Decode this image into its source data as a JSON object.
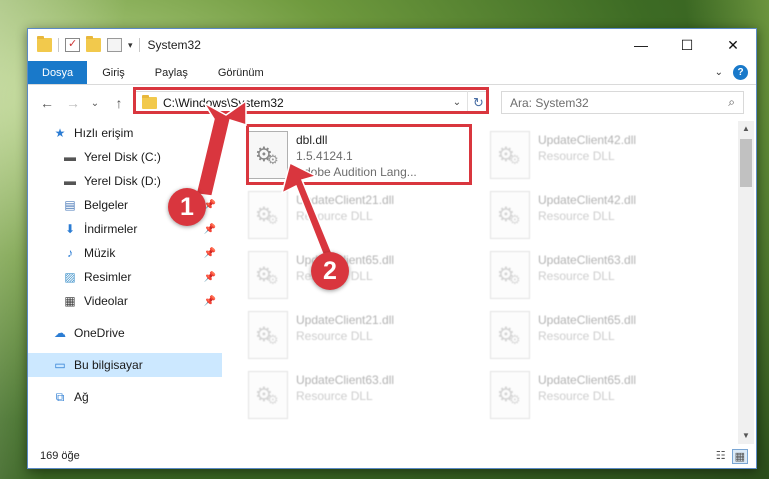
{
  "window": {
    "title": "System32",
    "min_label": "—",
    "max_label": "☐",
    "close_label": "✕"
  },
  "ribbon": {
    "tabs": [
      "Dosya",
      "Giriş",
      "Paylaş",
      "Görünüm"
    ],
    "help_label": "?"
  },
  "nav": {
    "back": "←",
    "forward": "→",
    "recent": "⌄",
    "up": "↑"
  },
  "address": {
    "path": "C:\\Windows\\System32",
    "refresh": "↻"
  },
  "search": {
    "placeholder": "Ara: System32",
    "icon": "⌕"
  },
  "sidebar": {
    "items": [
      {
        "label": "Hızlı erişim",
        "icon": "star-icon",
        "glyph": "★",
        "pinned": false
      },
      {
        "label": "Yerel Disk (C:)",
        "icon": "drive-icon",
        "glyph": "▬",
        "pinned": true
      },
      {
        "label": "Yerel Disk (D:)",
        "icon": "drive-icon",
        "glyph": "▬",
        "pinned": true
      },
      {
        "label": "Belgeler",
        "icon": "documents-icon",
        "glyph": "▤",
        "pinned": true
      },
      {
        "label": "İndirmeler",
        "icon": "downloads-icon",
        "glyph": "⬇",
        "pinned": true
      },
      {
        "label": "Müzik",
        "icon": "music-icon",
        "glyph": "♪",
        "pinned": true
      },
      {
        "label": "Resimler",
        "icon": "pictures-icon",
        "glyph": "▨",
        "pinned": true
      },
      {
        "label": "Videolar",
        "icon": "videos-icon",
        "glyph": "▦",
        "pinned": true
      },
      {
        "label": "OneDrive",
        "icon": "cloud-icon",
        "glyph": "☁",
        "pinned": false
      },
      {
        "label": "Bu bilgisayar",
        "icon": "computer-icon",
        "glyph": "▭",
        "pinned": false
      },
      {
        "label": "Ağ",
        "icon": "network-icon",
        "glyph": "⧉",
        "pinned": false
      }
    ],
    "pin_glyph": "📌"
  },
  "files": {
    "highlighted": {
      "name": "dbl.dll",
      "version": "1.5.4124.1",
      "description": "Adobe Audition Lang..."
    },
    "tiles": [
      {
        "name": "UpdateClient42.dll",
        "type": "Resource DLL"
      },
      {
        "name": "UpdateClient21.dll",
        "type": "Resource DLL"
      },
      {
        "name": "UpdateClient42.dll",
        "type": "Resource DLL"
      },
      {
        "name": "UpdateClient65.dll",
        "type": "Resource DLL"
      },
      {
        "name": "UpdateClient63.dll",
        "type": "Resource DLL"
      },
      {
        "name": "UpdateClient21.dll",
        "type": "Resource DLL"
      },
      {
        "name": "UpdateClient65.dll",
        "type": "Resource DLL"
      },
      {
        "name": "UpdateClient63.dll",
        "type": "Resource DLL"
      },
      {
        "name": "UpdateClient65.dll",
        "type": "Resource DLL"
      }
    ]
  },
  "status": {
    "count": "169 öğe"
  },
  "callouts": {
    "first": "1",
    "second": "2"
  },
  "colors": {
    "accent": "#1979ca",
    "highlight_red": "#d9363e",
    "selected_nav": "#cce8ff"
  }
}
